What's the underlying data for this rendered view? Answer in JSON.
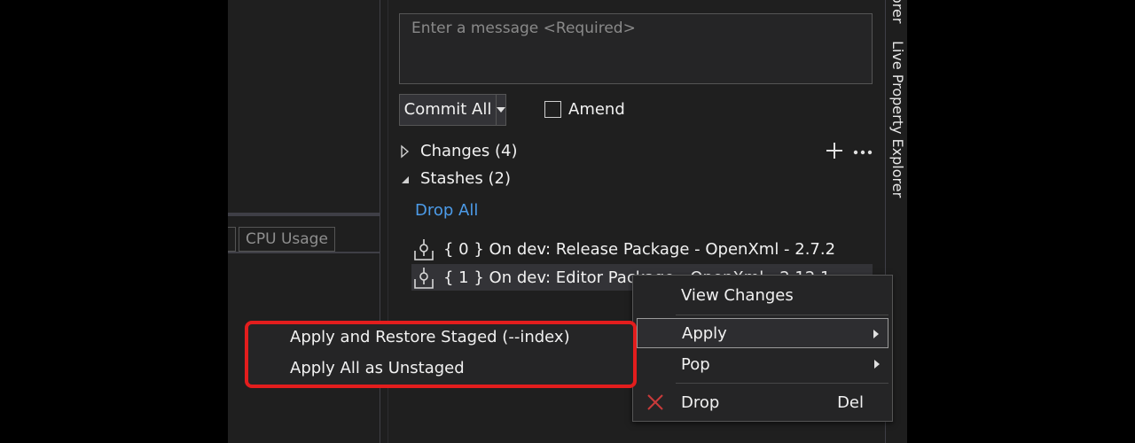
{
  "message": {
    "placeholder": "Enter a message <Required>"
  },
  "commit": {
    "label": "Commit All",
    "amend_label": "Amend"
  },
  "changes": {
    "label": "Changes (4)"
  },
  "stashes": {
    "label": "Stashes (2)",
    "drop_all": "Drop All",
    "items": [
      {
        "text": "{ 0 }  On dev: Release Package - OpenXml - 2.7.2"
      },
      {
        "text": "{ 1 }  On dev: Editor Package - OpenXml - 2.12.1"
      }
    ]
  },
  "left_pane": {
    "tab_label": "CPU Usage"
  },
  "side_tab": {
    "label": "Live Property Explorer",
    "partial_label": "orer"
  },
  "context_menu": {
    "items": [
      {
        "label": "View Changes"
      },
      {
        "label": "Apply"
      },
      {
        "label": "Pop"
      },
      {
        "label": "Drop",
        "shortcut": "Del"
      }
    ]
  },
  "submenu": {
    "items": [
      {
        "label": "Apply and Restore Staged (--index)"
      },
      {
        "label": "Apply All as Unstaged"
      }
    ]
  },
  "colors": {
    "accent_link": "#4c9be8",
    "highlight_border": "#e31d1d",
    "drop_icon": "#c93a3a"
  }
}
